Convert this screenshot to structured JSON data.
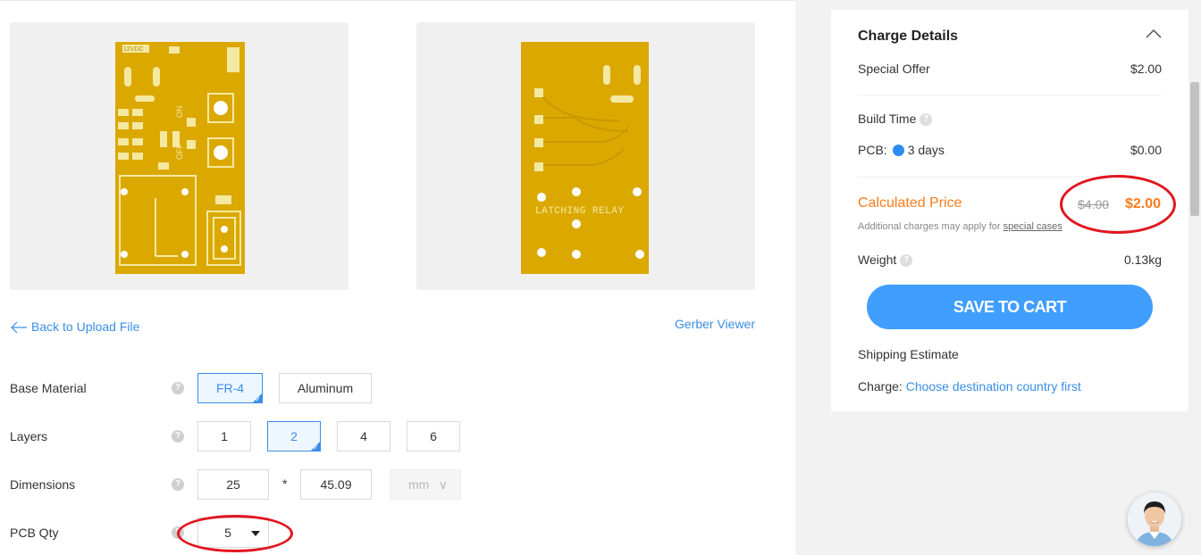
{
  "links": {
    "back": "Back to Upload File",
    "gerber": "Gerber Viewer"
  },
  "pcb_labels": {
    "voltage": "12VDC",
    "on": "ON",
    "off": "OFF",
    "relay": "LATCHING RELAY"
  },
  "options": {
    "base_material": {
      "label": "Base Material",
      "choices": [
        "FR-4",
        "Aluminum"
      ],
      "selected": "FR-4"
    },
    "layers": {
      "label": "Layers",
      "choices": [
        "1",
        "2",
        "4",
        "6"
      ],
      "selected": "2"
    },
    "dimensions": {
      "label": "Dimensions",
      "width": "25",
      "separator": "*",
      "height": "45.09",
      "unit": "mm"
    },
    "pcb_qty": {
      "label": "PCB Qty",
      "value": "5"
    }
  },
  "charge_details": {
    "title": "Charge Details",
    "special_offer_label": "Special Offer",
    "special_offer_value": "$2.00",
    "build_time_label": "Build Time",
    "pcb_label": "PCB:",
    "pcb_days": "3 days",
    "pcb_value": "$0.00",
    "calculated_price_label": "Calculated Price",
    "old_price": "$4.00",
    "new_price": "$2.00",
    "note_text": "Additional charges may apply for ",
    "note_link": "special cases",
    "weight_label": "Weight",
    "weight_value": "0.13kg",
    "save_button": "SAVE TO CART",
    "shipping_estimate": "Shipping Estimate",
    "charge_label": "Charge:",
    "charge_link": "Choose destination country first"
  },
  "colors": {
    "accent": "#3a8ee6",
    "button": "#409eff",
    "price": "#ff7a1a",
    "annotation": "#e0161f",
    "pcb": "#dba800"
  }
}
